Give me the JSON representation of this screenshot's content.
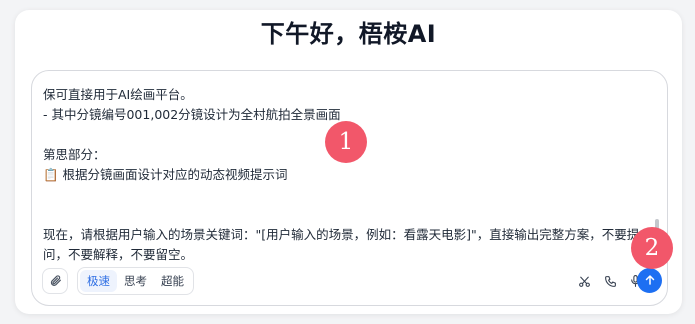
{
  "header": {
    "greeting": "下午好，梧桉AI"
  },
  "composer": {
    "content": "保可直接用于AI绘画平台。\n- 其中分镜编号001,002分镜设计为全村航拍全景画面\n\n第思部分：\n📋 根据分镜画面设计对应的动态视频提示词\n\n\n现在，请根据用户输入的场景关键词：\"[用户输入的场景，例如：看露天电影]\"，直接输出完整方案，不要提问，不要解释，不要留空。"
  },
  "toolbar": {
    "attach_icon": "paperclip-icon",
    "modes": [
      {
        "label": "极速",
        "active": true
      },
      {
        "label": "思考",
        "active": false
      },
      {
        "label": "超能",
        "active": false
      }
    ],
    "scissors_icon": "scissors-icon",
    "phone_icon": "phone-icon",
    "mic_icon": "microphone-icon",
    "send_icon": "arrow-up-icon"
  },
  "markers": {
    "m1": "1",
    "m2": "2"
  },
  "colors": {
    "accent": "#1d6ff2",
    "active_mode_bg": "#eef3fd",
    "marker": "#f2576a"
  }
}
